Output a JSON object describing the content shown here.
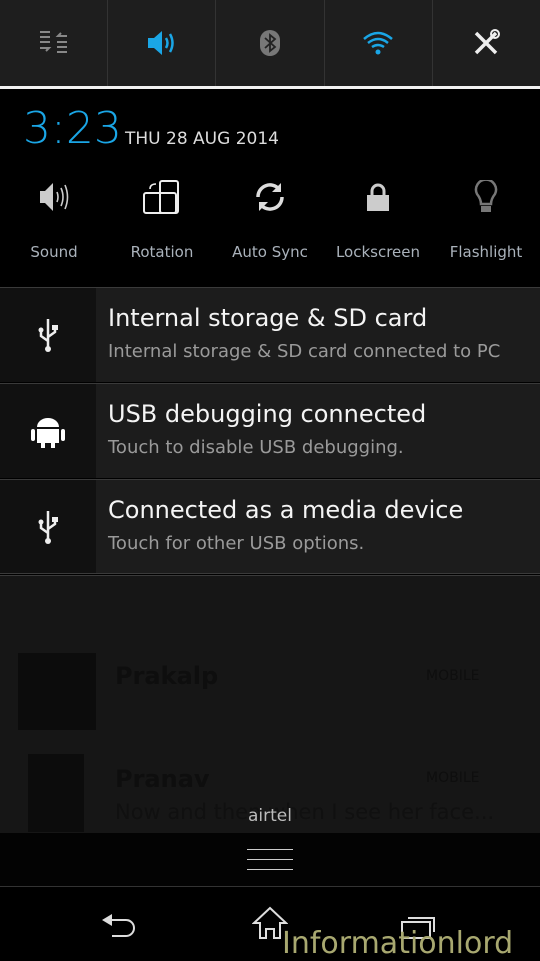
{
  "toggles": [
    {
      "icon": "quick-settings-list-icon",
      "active": false
    },
    {
      "icon": "sound-icon",
      "active": true
    },
    {
      "icon": "bluetooth-icon",
      "active": false
    },
    {
      "icon": "wifi-icon",
      "active": true
    },
    {
      "icon": "settings-tools-icon",
      "active": false
    }
  ],
  "colors": {
    "accent": "#1aa6e6"
  },
  "header": {
    "time": "3:23",
    "date": "THU 28 AUG 2014"
  },
  "quick": [
    {
      "label": "Sound",
      "icon": "speaker-icon"
    },
    {
      "label": "Rotation",
      "icon": "rotation-icon"
    },
    {
      "label": "Auto Sync",
      "icon": "sync-icon"
    },
    {
      "label": "Lockscreen",
      "icon": "lock-icon"
    },
    {
      "label": "Flashlight",
      "icon": "bulb-icon"
    }
  ],
  "notifications": [
    {
      "title": "Internal storage & SD card",
      "subtitle": "Internal storage & SD card connected to PC",
      "icon": "usb-icon"
    },
    {
      "title": "USB debugging connected",
      "subtitle": "Touch to disable USB debugging.",
      "icon": "android-icon"
    },
    {
      "title": "Connected as a media device",
      "subtitle": "Touch for other USB options.",
      "icon": "usb-icon"
    }
  ],
  "background": {
    "contacts": [
      {
        "name": "Prakalp",
        "type": "MOBILE"
      },
      {
        "name": "Pranav",
        "type": "MOBILE",
        "message": "Now and then when I see her face..."
      }
    ]
  },
  "carrier": "airtel",
  "watermark": "Informationlord"
}
